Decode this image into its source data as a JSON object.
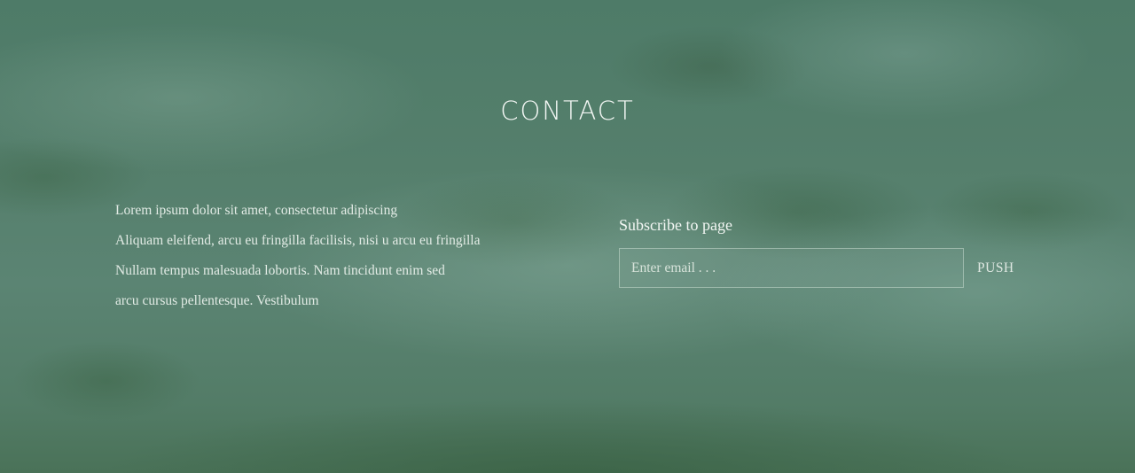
{
  "contact": {
    "title": "CONTACT",
    "paragraph_lines": [
      "Lorem ipsum dolor sit amet, consectetur adipiscing",
      "Aliquam eleifend, arcu eu fringilla facilisis, nisi u  arcu eu fringilla",
      "Nullam tempus malesuada lobortis. Nam tincidunt enim sed",
      "arcu cursus pellentesque. Vestibulum"
    ]
  },
  "subscribe": {
    "heading": "Subscribe to page",
    "email_placeholder": "Enter email . . .",
    "email_value": "",
    "button_label": "PUSH"
  },
  "colors": {
    "background_green": "#557f6c",
    "text_light": "#e8efe9"
  }
}
